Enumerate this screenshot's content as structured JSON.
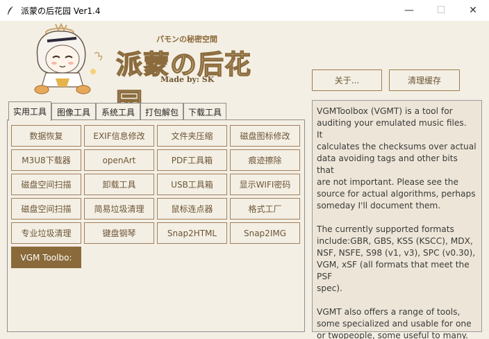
{
  "window": {
    "title": "派蒙の后花园 Ver1.4",
    "controls": {
      "minimize": "—",
      "maximize": "☐",
      "close": "✕"
    }
  },
  "banner": {
    "logo_sub": "パモンの秘密空間",
    "logo_main": "派蒙の后花园",
    "logo_madeby": "Made by: SK",
    "about_button": "关于...",
    "clear_cache_button": "清理缓存"
  },
  "tabs": [
    {
      "label": "实用工具",
      "active": true
    },
    {
      "label": "图像工具",
      "active": false
    },
    {
      "label": "系统工具",
      "active": false
    },
    {
      "label": "打包解包",
      "active": false
    },
    {
      "label": "下载工具",
      "active": false
    }
  ],
  "tools": [
    [
      "数据恢复",
      "EXIF信息修改",
      "文件夹压缩",
      "磁盘图标修改"
    ],
    [
      "M3U8下载器",
      "openArt",
      "PDF工具箱",
      "痕迹擦除"
    ],
    [
      "磁盘空间扫描",
      "卸载工具",
      "USB工具箱",
      "显示WIFI密码"
    ],
    [
      "磁盘空间扫描",
      "简易垃圾清理",
      "鼠标连点器",
      "格式工厂"
    ],
    [
      "专业垃圾清理",
      "键盘钢琴",
      "Snap2HTML",
      "Snap2IMG"
    ],
    [
      "VGM Toolbo:"
    ]
  ],
  "selected_tool": "VGM Toolbo:",
  "info_text": "VGMToolbox (VGMT) is a tool for\nauditing your emulated music files.  It\ncalculates the checksums over actual\ndata avoiding tags and other bits that\nare not important. Please see the\nsource for actual algorithms, perhaps\nsomeday I'll document them.\n\nThe currently supported formats\ninclude:GBR, GBS, KSS (KSCC), MDX,\nNSF, NSFE, S98 (v1, v3), SPC (v0.30),\nVGM, xSF (all formats that meet the PSF\nspec).\n\nVGMT also offers a range of tools,\nsome specialized and usable for one\nor twopeople, some useful to many.",
  "colors": {
    "background": "#f4efe4",
    "accent_brown": "#8a6a3a",
    "border_brown": "#9c7a4d",
    "info_bg": "#ede6d8"
  }
}
